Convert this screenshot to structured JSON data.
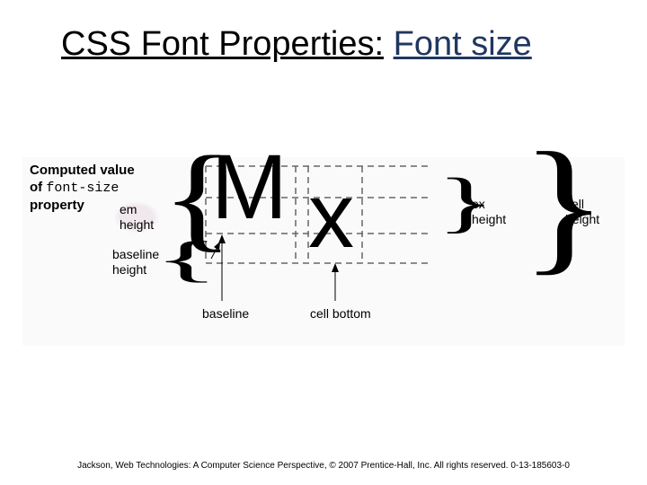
{
  "title": {
    "main": "CSS Font Properties:",
    "sub": "Font size"
  },
  "computed": {
    "line1": "Computed value",
    "line2_of": "of ",
    "line2_code": "font-size",
    "line3": "property"
  },
  "labels": {
    "em_height": "em height",
    "baseline_height": "baseline height",
    "ex_height": "ex height",
    "cell_height": "cell height",
    "baseline": "baseline",
    "cell_bottom": "cell bottom"
  },
  "glyphs": {
    "M": "M",
    "x": "x"
  },
  "footer": "Jackson, Web Technologies: A Computer Science Perspective, © 2007 Prentice-Hall, Inc. All rights reserved. 0-13-185603-0"
}
